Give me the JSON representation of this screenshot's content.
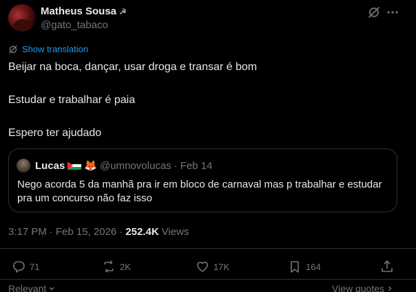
{
  "author": {
    "display_name": "Matheus Sousa",
    "name_emoji": "☭",
    "handle": "@gato_tabaco"
  },
  "translation_label": "Show translation",
  "tweet_lines": [
    "Beijar na boca, dançar, usar droga e transar é bom",
    "Estudar e trabalhar é paia",
    "Espero ter ajudado"
  ],
  "quote": {
    "name": "Lucas",
    "fox_emoji": "🦊",
    "handle": "@umnovolucas",
    "separator": "·",
    "date": "Feb 14",
    "text": "Nego acorda 5 da manhã pra ir em bloco de carnaval mas p trabalhar e estudar pra um concurso não faz isso"
  },
  "meta": {
    "time": "3:17 PM",
    "separator": "·",
    "date": "Feb 15, 2026",
    "separator2": "·",
    "views_count": "252.4K",
    "views_label": "Views"
  },
  "actions": {
    "replies": "71",
    "reposts": "2K",
    "likes": "17K",
    "bookmarks": "164"
  },
  "footer": {
    "relevant": "Relevant",
    "view_quotes": "View quotes"
  },
  "icons": {
    "grok": "grok-icon",
    "more": "more-icon",
    "translate": "translate-icon",
    "reply": "reply-icon",
    "repost": "repost-icon",
    "like": "heart-icon",
    "bookmark": "bookmark-icon",
    "share": "share-icon"
  },
  "colors": {
    "background": "#000000",
    "text": "#e7e9ea",
    "secondary": "#71767b",
    "accent": "#1d9bf0",
    "border": "#2f3336"
  }
}
